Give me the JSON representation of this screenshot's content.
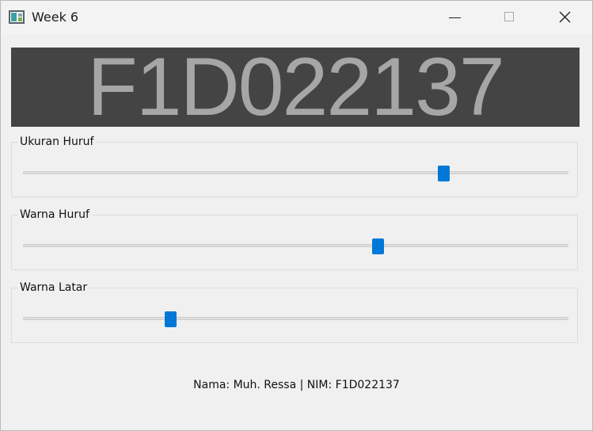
{
  "window": {
    "title": "Week 6",
    "icon": "app-window-icon",
    "controls": {
      "minimize": "minimize-icon",
      "maximize": "maximize-icon",
      "close": "close-icon"
    }
  },
  "display": {
    "text": "F1D022137",
    "background_color": "#444444",
    "text_color": "#a6a6a6"
  },
  "sliders": [
    {
      "label": "Ukuran Huruf",
      "value_fraction": 0.77
    },
    {
      "label": "Warna Huruf",
      "value_fraction": 0.65
    },
    {
      "label": "Warna Latar",
      "value_fraction": 0.27
    }
  ],
  "footer": {
    "text": "Nama: Muh. Ressa | NIM: F1D022137"
  },
  "colors": {
    "accent": "#0078d7"
  }
}
